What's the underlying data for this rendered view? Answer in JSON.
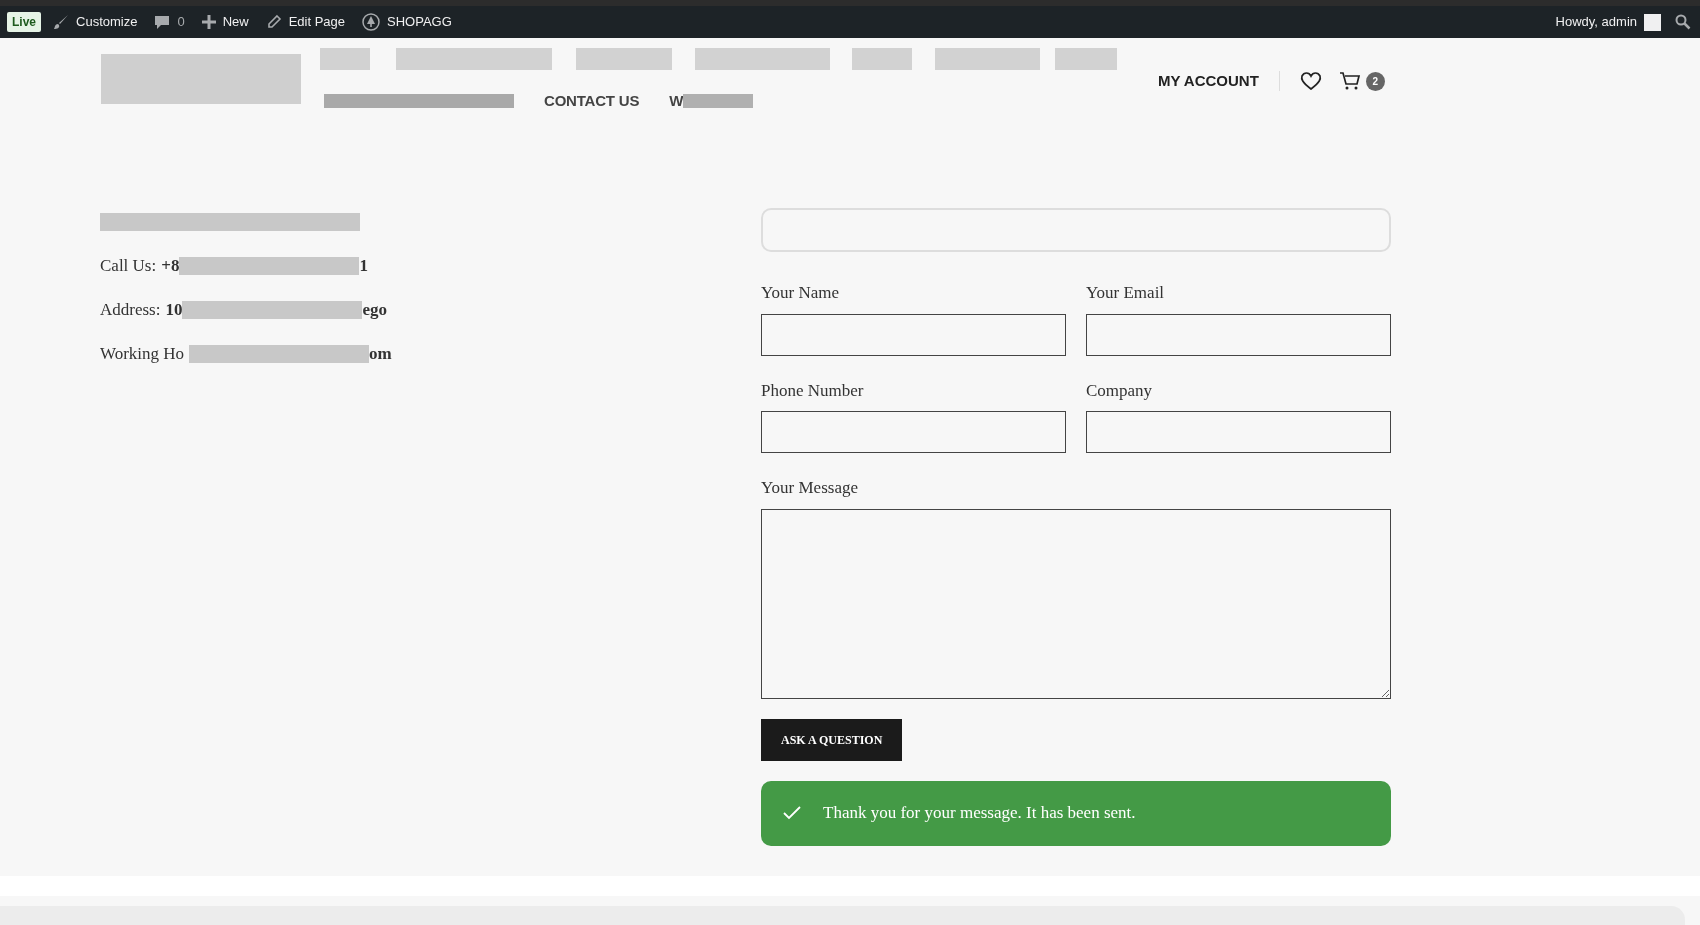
{
  "admin_bar": {
    "live_badge": "Live",
    "items": [
      {
        "kind": "brush",
        "label": "Customize"
      },
      {
        "kind": "comment",
        "label": "0"
      },
      {
        "kind": "plus",
        "label": "New"
      },
      {
        "kind": "pencil",
        "label": "Edit Page"
      },
      {
        "kind": "site",
        "label": "SHOPAGG"
      }
    ],
    "greeting": "Howdy, admin"
  },
  "header": {
    "nav_second_row": [
      {
        "label": "CONTACT US"
      },
      {
        "label": "W"
      }
    ],
    "account_link": "MY ACCOUNT",
    "cart_count": "2"
  },
  "contact_info": [
    {
      "label": "Call Us:",
      "value_start": "+8",
      "value_end": "1"
    },
    {
      "label": "Address:",
      "value_start": "10",
      "value_end": "ego"
    },
    {
      "label": "Working Ho",
      "value_end": "om"
    }
  ],
  "form": {
    "fields": [
      {
        "label": "Your Name",
        "kind": "input"
      },
      {
        "label": "Your Email",
        "kind": "input"
      },
      {
        "label": "Phone Number",
        "kind": "input"
      },
      {
        "label": "Company",
        "kind": "input"
      },
      {
        "label": "Your Message",
        "kind": "textarea"
      }
    ],
    "submit": "ASK A QUESTION",
    "success_message": "Thank you for your message. It has been sent."
  }
}
